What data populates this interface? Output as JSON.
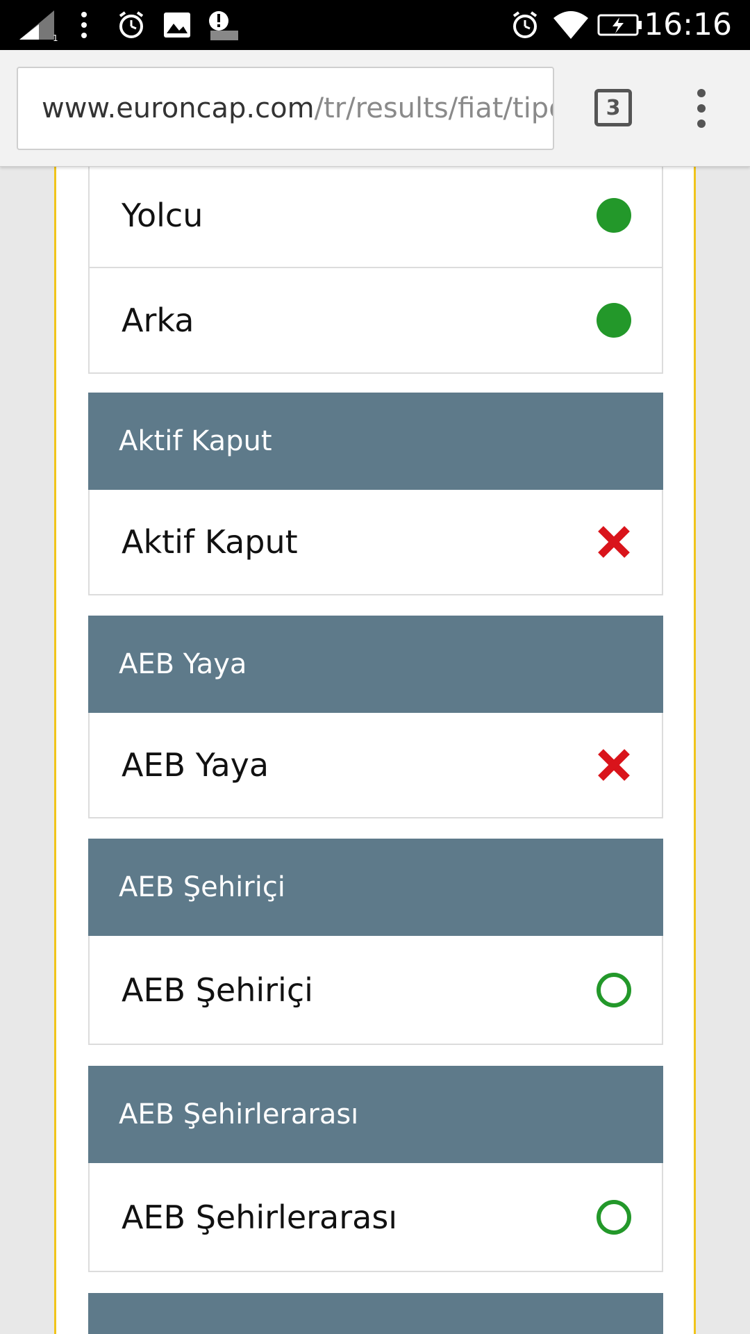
{
  "status_bar": {
    "time": "16:16",
    "icons": [
      "signal-icon",
      "more-icon",
      "alarm-icon",
      "image-icon",
      "warning-icon",
      "alarm-icon",
      "wifi-icon",
      "battery-charging-icon"
    ]
  },
  "browser": {
    "url_host": "www.euroncap.com",
    "url_path": "/tr/results/fiat/tipo,",
    "tab_count": "3"
  },
  "top_rows": [
    {
      "label": "Yolcu",
      "status": "filled-dot"
    },
    {
      "label": "Arka",
      "status": "filled-dot"
    }
  ],
  "sections": [
    {
      "header": "Aktif Kaput",
      "row_label": "Aktif Kaput",
      "status": "cross"
    },
    {
      "header": "AEB Yaya",
      "row_label": "AEB Yaya",
      "status": "cross"
    },
    {
      "header": "AEB Şehiriçi",
      "row_label": "AEB Şehiriçi",
      "status": "empty-dot"
    },
    {
      "header": "AEB Şehirlerarası",
      "row_label": "AEB Şehirlerarası",
      "status": "empty-dot"
    }
  ],
  "colors": {
    "header_bg": "#5e7a8a",
    "positive": "#23982a",
    "negative": "#d9141b",
    "card_border": "#f0c41b"
  }
}
